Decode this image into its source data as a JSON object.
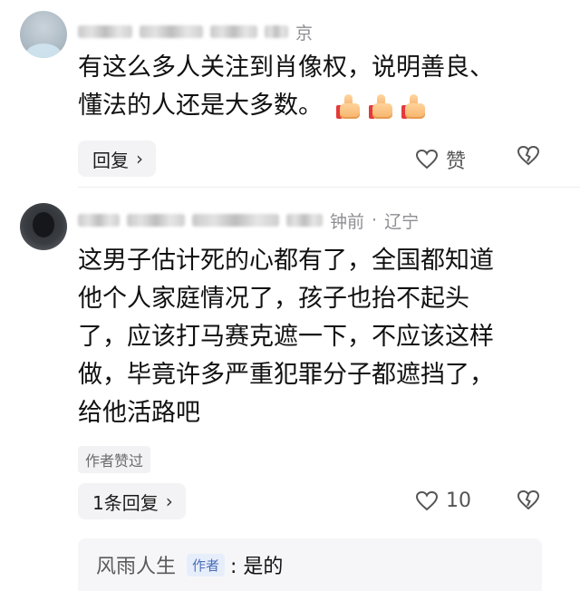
{
  "comments": [
    {
      "location": "京",
      "text_line1": "有这么多人关注到肖像权，说明善良、",
      "text_line2": "懂法的人还是大多数。",
      "emoji_count": 3,
      "reply_label": "回复",
      "like_label": "赞"
    },
    {
      "meta_time": "钟前",
      "meta_sep": "·",
      "location": "辽宁",
      "text_lines": [
        "这男子估计死的心都有了，全国都知道",
        "他个人家庭情况了，孩子也抬不起头",
        "了，应该打马赛克遮一下，不应该这样",
        "做，毕竟许多严重犯罪分子都遮挡了，",
        "给他活路吧"
      ],
      "author_liked_badge": "作者赞过",
      "reply_count_label": "1条回复",
      "like_count": "10",
      "sub_reply": {
        "name": "风雨人生",
        "author_tag": "作者",
        "content": ": 是的"
      }
    }
  ],
  "icons": {
    "heart": "heart-outline-icon",
    "dislike": "heart-broken-icon",
    "chevron": "chevron-right-icon",
    "thumb": "thumbs-up-emoji-icon"
  }
}
